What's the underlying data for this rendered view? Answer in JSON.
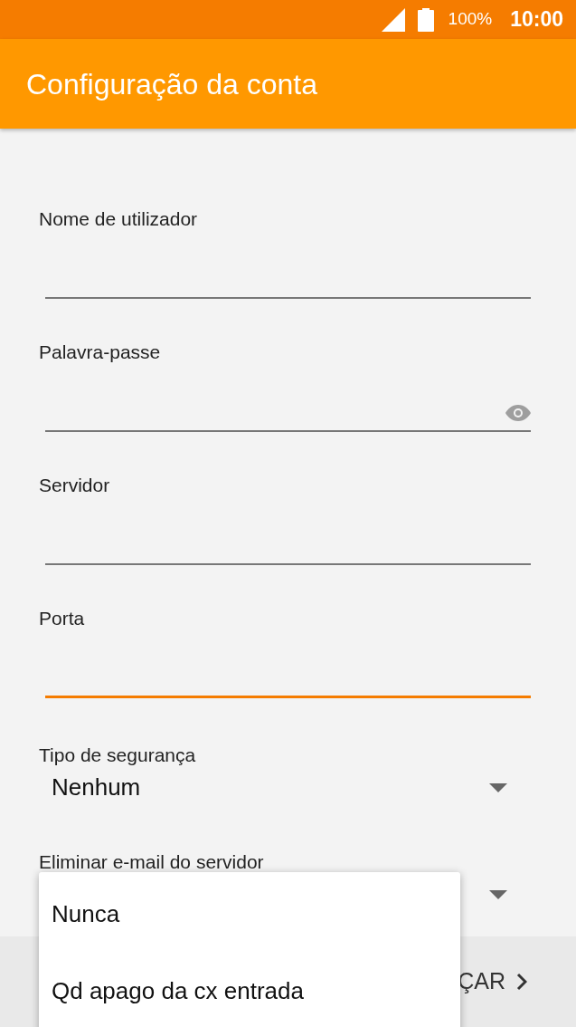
{
  "status_bar": {
    "battery": "100%",
    "time": "10:00"
  },
  "app_bar": {
    "title": "Configuração da conta"
  },
  "fields": [
    {
      "label": "Nome de utilizador",
      "kind": "text",
      "focused": false
    },
    {
      "label": "Palavra-passe",
      "kind": "password",
      "focused": false
    },
    {
      "label": "Servidor",
      "kind": "text",
      "focused": false
    },
    {
      "label": "Porta",
      "kind": "text",
      "focused": true
    }
  ],
  "dropdowns": [
    {
      "label": "Tipo de segurança",
      "value": "Nenhum"
    },
    {
      "label": "Eliminar e-mail do servidor"
    }
  ],
  "bottom_bar": {
    "next_button": "ÇAR"
  },
  "popup_menu": {
    "items": [
      "Nunca",
      "Qd apago da cx entrada"
    ]
  }
}
